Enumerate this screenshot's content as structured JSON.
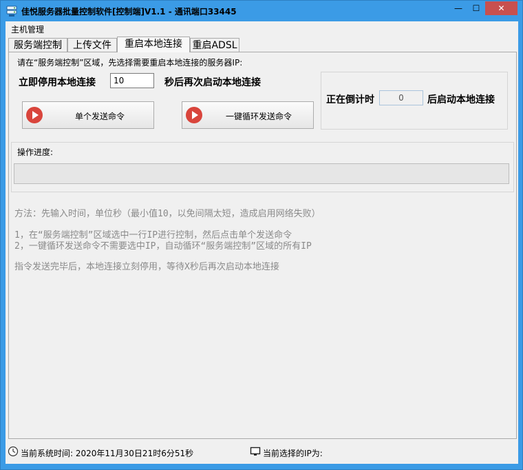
{
  "window": {
    "title": "佳悦服务器批量控制软件[控制端]V1.1 - 通讯端口33445",
    "min_glyph": "—",
    "max_glyph": "☐",
    "close_glyph": "✕",
    "titlebar_color": "#3b9be6",
    "close_color": "#c7504f"
  },
  "menu": {
    "items": [
      {
        "label": "主机管理"
      }
    ]
  },
  "tabs": [
    {
      "label": "服务端控制",
      "active": false
    },
    {
      "label": "上传文件",
      "active": false
    },
    {
      "label": "重启本地连接",
      "active": true
    },
    {
      "label": "重启ADSL",
      "active": false
    }
  ],
  "panel": {
    "hint": "请在“服务端控制”区域，先选择需要重启本地连接的服务器IP:",
    "stop_label": "立即停用本地连接",
    "seconds_value": "10",
    "after_label": "秒后再次启动本地连接",
    "counting_label": "正在倒计时",
    "countdown_value": "0",
    "restart_label": "后启动本地连接",
    "single_button": "单个发送命令",
    "loop_button": "一键循环发送命令",
    "progress_label": "操作进度:",
    "progress_value": 0,
    "instructions": {
      "method": "方法：先输入时间，单位秒（最小值10，以免间隔太短，造成启用网络失败）",
      "step1": "1，在“服务端控制”区域选中一行IP进行控制，然后点击单个发送命令",
      "step2": "2，一键循环发送命令不需要选中IP，自动循环“服务端控制”区域的所有IP",
      "note": "指令发送完毕后，本地连接立刻停用，等待X秒后再次启动本地连接"
    }
  },
  "status": {
    "time_label": "当前系统时间: 2020年11月30日21时6分51秒",
    "ip_label": "当前选择的IP为:"
  },
  "icons": {
    "app": "server-app-icon",
    "play": "play-icon",
    "clock": "clock-icon",
    "monitor": "monitor-icon"
  }
}
